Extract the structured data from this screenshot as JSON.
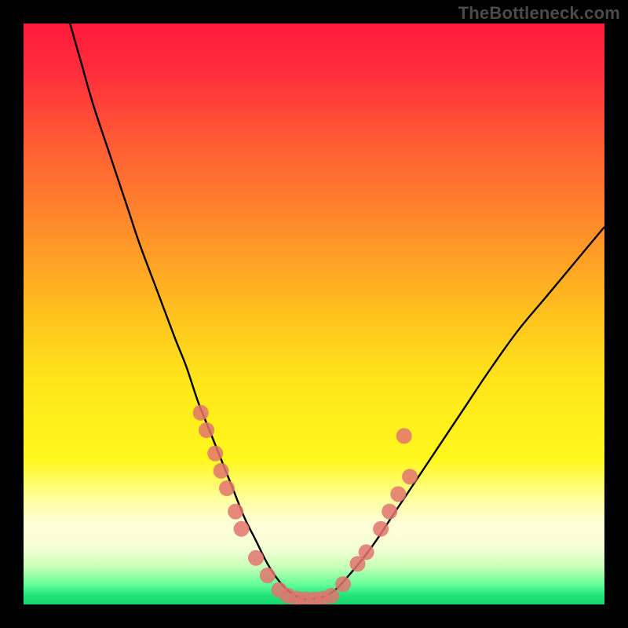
{
  "watermark": "TheBottleneck.com",
  "colors": {
    "frame": "#000000",
    "curve": "#000000",
    "marker_fill": "#e2746f",
    "marker_stroke": "#c9544f",
    "gradient_stops": [
      {
        "offset": 0.0,
        "color": "#ff1a3a"
      },
      {
        "offset": 0.08,
        "color": "#ff2c3c"
      },
      {
        "offset": 0.2,
        "color": "#ff5a34"
      },
      {
        "offset": 0.35,
        "color": "#ff8c2a"
      },
      {
        "offset": 0.5,
        "color": "#ffc21e"
      },
      {
        "offset": 0.62,
        "color": "#ffe61a"
      },
      {
        "offset": 0.75,
        "color": "#fff81c"
      },
      {
        "offset": 0.82,
        "color": "#ffffa0"
      },
      {
        "offset": 0.86,
        "color": "#ffffd8"
      },
      {
        "offset": 0.905,
        "color": "#f4ffd4"
      },
      {
        "offset": 0.935,
        "color": "#c8ffb8"
      },
      {
        "offset": 0.965,
        "color": "#66ff99"
      },
      {
        "offset": 0.985,
        "color": "#1fe47a"
      },
      {
        "offset": 1.0,
        "color": "#17d86f"
      }
    ]
  },
  "chart_data": {
    "type": "line",
    "title": "",
    "xlabel": "",
    "ylabel": "",
    "xlim": [
      0,
      100
    ],
    "ylim": [
      0,
      100
    ],
    "series": [
      {
        "name": "bottleneck-curve",
        "x": [
          8,
          10,
          12,
          15,
          18,
          20,
          23,
          26,
          28,
          30,
          32,
          34,
          36,
          38,
          40,
          42,
          44,
          46,
          48,
          50,
          53,
          56,
          60,
          64,
          68,
          72,
          76,
          80,
          85,
          90,
          95,
          100
        ],
        "y": [
          100,
          93,
          86,
          77,
          68,
          62,
          54,
          46,
          41,
          35,
          30,
          25,
          20,
          15,
          11,
          7,
          4,
          2,
          1,
          1,
          2,
          5,
          10,
          16,
          22,
          28,
          34,
          40,
          47,
          53,
          59,
          65
        ]
      }
    ],
    "markers": {
      "name": "highlighted-points",
      "points": [
        {
          "x": 30.5,
          "y": 33
        },
        {
          "x": 31.5,
          "y": 30
        },
        {
          "x": 33.0,
          "y": 26
        },
        {
          "x": 34.0,
          "y": 23
        },
        {
          "x": 35.0,
          "y": 20
        },
        {
          "x": 36.5,
          "y": 16
        },
        {
          "x": 37.5,
          "y": 13
        },
        {
          "x": 40.0,
          "y": 8
        },
        {
          "x": 42.0,
          "y": 5
        },
        {
          "x": 44.0,
          "y": 2.5
        },
        {
          "x": 45.5,
          "y": 1.5
        },
        {
          "x": 47.0,
          "y": 1.0
        },
        {
          "x": 48.5,
          "y": 0.9
        },
        {
          "x": 50.0,
          "y": 0.9
        },
        {
          "x": 51.5,
          "y": 1.0
        },
        {
          "x": 53.0,
          "y": 1.5
        },
        {
          "x": 55.0,
          "y": 3.5
        },
        {
          "x": 57.5,
          "y": 7
        },
        {
          "x": 59.0,
          "y": 9
        },
        {
          "x": 61.5,
          "y": 13
        },
        {
          "x": 63.0,
          "y": 16
        },
        {
          "x": 64.5,
          "y": 19
        },
        {
          "x": 65.5,
          "y": 29
        },
        {
          "x": 66.5,
          "y": 22
        }
      ]
    }
  }
}
